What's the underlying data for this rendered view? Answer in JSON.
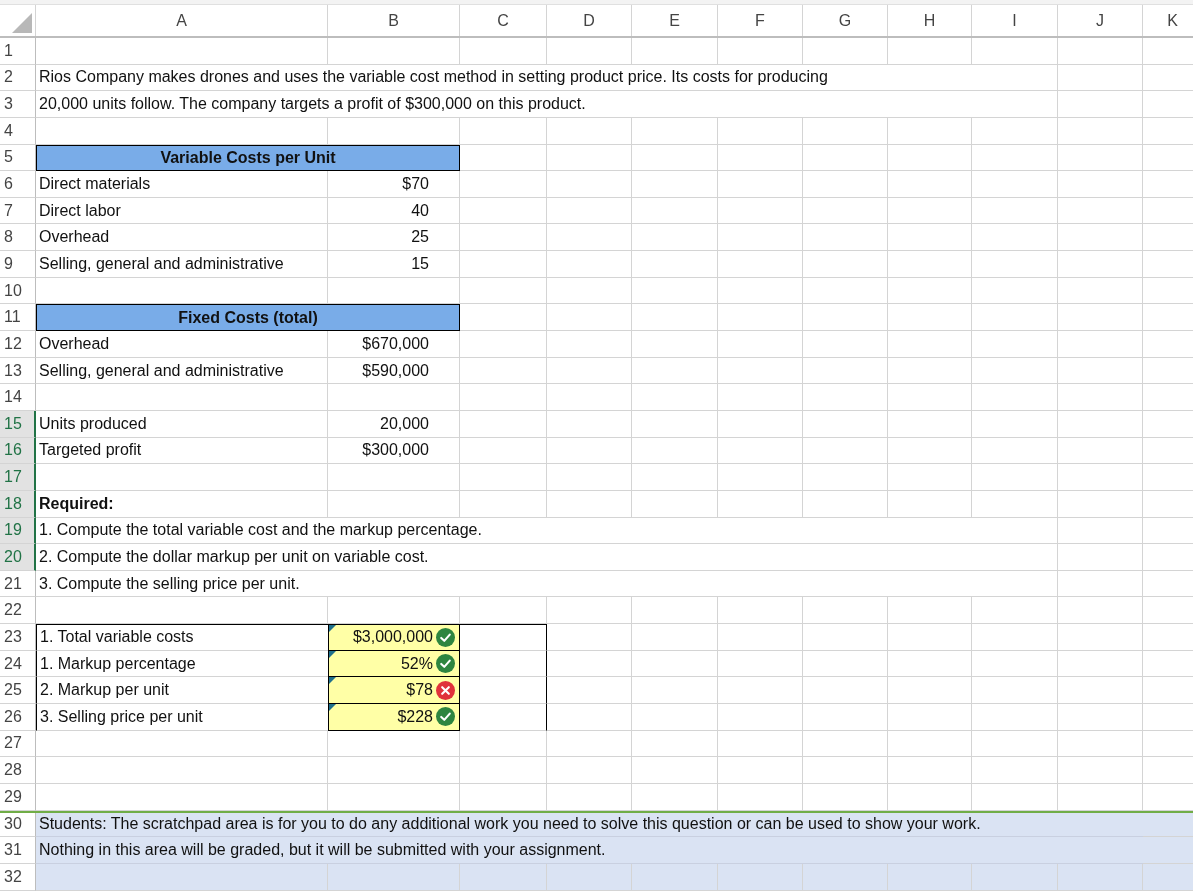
{
  "columns": [
    "A",
    "B",
    "C",
    "D",
    "E",
    "F",
    "G",
    "H",
    "I",
    "J",
    "K"
  ],
  "rows": [
    {
      "number": "1",
      "selected": false,
      "kind": "blank"
    },
    {
      "number": "2",
      "selected": false,
      "kind": "note",
      "text": "Rios Company makes drones and uses the variable cost method in setting product price. Its costs for producing"
    },
    {
      "number": "3",
      "selected": false,
      "kind": "note",
      "text": "20,000 units follow. The company targets a profit of $300,000 on this product."
    },
    {
      "number": "4",
      "selected": false,
      "kind": "blank"
    },
    {
      "number": "5",
      "selected": false,
      "kind": "header",
      "text": "Variable Costs per Unit"
    },
    {
      "number": "6",
      "selected": false,
      "kind": "item",
      "label": "Direct materials",
      "value": "$70"
    },
    {
      "number": "7",
      "selected": false,
      "kind": "item",
      "label": "Direct labor",
      "value": "40"
    },
    {
      "number": "8",
      "selected": false,
      "kind": "item",
      "label": "Overhead",
      "value": "25"
    },
    {
      "number": "9",
      "selected": false,
      "kind": "item",
      "label": "Selling, general and administrative",
      "value": "15"
    },
    {
      "number": "10",
      "selected": false,
      "kind": "blank"
    },
    {
      "number": "11",
      "selected": false,
      "kind": "header",
      "text": "Fixed Costs (total)"
    },
    {
      "number": "12",
      "selected": false,
      "kind": "item",
      "label": "Overhead",
      "value": "$670,000"
    },
    {
      "number": "13",
      "selected": false,
      "kind": "item",
      "label": "Selling, general and administrative",
      "value": "$590,000"
    },
    {
      "number": "14",
      "selected": false,
      "kind": "blank"
    },
    {
      "number": "15",
      "selected": true,
      "kind": "item",
      "label": "Units produced",
      "value": "20,000"
    },
    {
      "number": "16",
      "selected": true,
      "kind": "item",
      "label": "Targeted profit",
      "value": "$300,000"
    },
    {
      "number": "17",
      "selected": true,
      "kind": "blank"
    },
    {
      "number": "18",
      "selected": true,
      "kind": "bold",
      "text": "Required:"
    },
    {
      "number": "19",
      "selected": true,
      "kind": "note",
      "text": "1. Compute the total variable cost and the markup percentage."
    },
    {
      "number": "20",
      "selected": true,
      "kind": "note",
      "text": "2. Compute the dollar markup per unit on variable cost."
    },
    {
      "number": "21",
      "selected": false,
      "kind": "note",
      "text": "3. Compute the selling price per unit."
    },
    {
      "number": "22",
      "selected": false,
      "kind": "blank"
    },
    {
      "number": "23",
      "selected": false,
      "kind": "answer",
      "label": "1. Total variable costs",
      "value": "$3,000,000",
      "correct": true
    },
    {
      "number": "24",
      "selected": false,
      "kind": "answer",
      "label": "1. Markup percentage",
      "value": "52%",
      "correct": true
    },
    {
      "number": "25",
      "selected": false,
      "kind": "answer",
      "label": "2. Markup per unit",
      "value": "$78",
      "correct": false
    },
    {
      "number": "26",
      "selected": false,
      "kind": "answer",
      "label": "3. Selling price per unit",
      "value": "$228",
      "correct": true
    },
    {
      "number": "27",
      "selected": false,
      "kind": "blank"
    },
    {
      "number": "28",
      "selected": false,
      "kind": "blank"
    },
    {
      "number": "29",
      "selected": false,
      "kind": "blank"
    },
    {
      "number": "30",
      "selected": false,
      "kind": "scratch",
      "text": "Students: The scratchpad area is for you to do any additional work you need to solve this question or can be used to show your work."
    },
    {
      "number": "31",
      "selected": false,
      "kind": "scratch",
      "text": "Nothing in this area will be graded, but it will be submitted with your assignment."
    },
    {
      "number": "32",
      "selected": false,
      "kind": "scratch"
    }
  ]
}
